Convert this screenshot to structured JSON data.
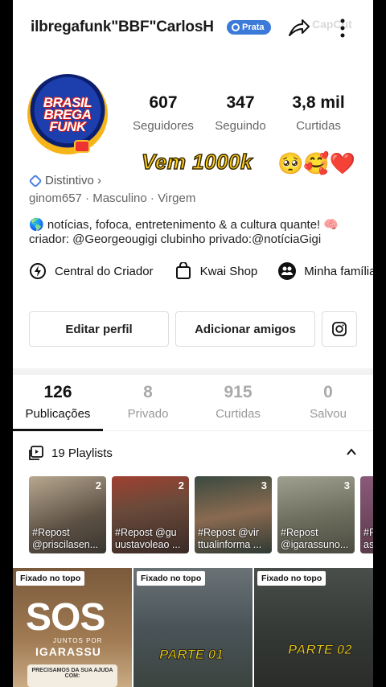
{
  "header": {
    "username": "ilbregafunk\"BBF\"CarlosH",
    "badge": "Prata",
    "watermark": "CapCut"
  },
  "avatar": {
    "text_line1": "BRASIL",
    "text_line2": "BREGA",
    "text_line3": "FUNK"
  },
  "stats": [
    {
      "value": "607",
      "label": "Seguidores"
    },
    {
      "value": "347",
      "label": "Seguindo"
    },
    {
      "value": "3,8 mil",
      "label": "Curtidas"
    }
  ],
  "overlay": {
    "text": "Vem 1000k",
    "emojis": "🥺🥰❤️"
  },
  "profile": {
    "badge_link": "Distintivo ›",
    "meta": "ginom657 · Masculino · Virgem",
    "bio_line1": "🌎 notícias, fofoca, entretenimento & a cultura quante! 🧠",
    "bio_line2": "criador: @Georgeougigi clubinho privado:@notíciaGigi"
  },
  "shortcuts": [
    {
      "label": "Central do Criador",
      "icon": "creator-center-icon"
    },
    {
      "label": "Kwai Shop",
      "icon": "shopping-bag-icon"
    },
    {
      "label": "Minha família",
      "icon": "family-icon"
    }
  ],
  "actions": {
    "edit": "Editar perfil",
    "add": "Adicionar amigos",
    "instagram_icon": "instagram-icon"
  },
  "tabs": [
    {
      "value": "126",
      "label": "Publicações"
    },
    {
      "value": "8",
      "label": "Privado"
    },
    {
      "value": "915",
      "label": "Curtidas"
    },
    {
      "value": "0",
      "label": "Salvou"
    }
  ],
  "playlists": {
    "title": "19 Playlists",
    "items": [
      {
        "count": "2",
        "caption": "#Repost\n@priscilasen...",
        "color": "#7a6a5a"
      },
      {
        "count": "2",
        "caption": "#Repost @gu\nuustavoleao ...",
        "color": "#6e4c3c"
      },
      {
        "count": "3",
        "caption": "#Repost @vir\nttualinforma ...",
        "color": "#4c5a4e"
      },
      {
        "count": "3",
        "caption": "#Repost\n@igarassuno...",
        "color": "#808070"
      },
      {
        "count": "",
        "caption": "#R\nasi",
        "color": "#6a4c6c"
      }
    ]
  },
  "grid": {
    "pinned_label": "Fixado no topo",
    "items": [
      {
        "title": "SOS",
        "sub1": "JUNTOS POR",
        "sub2": "IGARASSU",
        "help": "PRECISAMOS DA SUA AJUDA COM:",
        "color": "#8a6a4a"
      },
      {
        "title": "PARTE 01",
        "color": "#4f5a5e"
      },
      {
        "title": "PARTE 02",
        "color": "#3a3d3a"
      }
    ]
  }
}
